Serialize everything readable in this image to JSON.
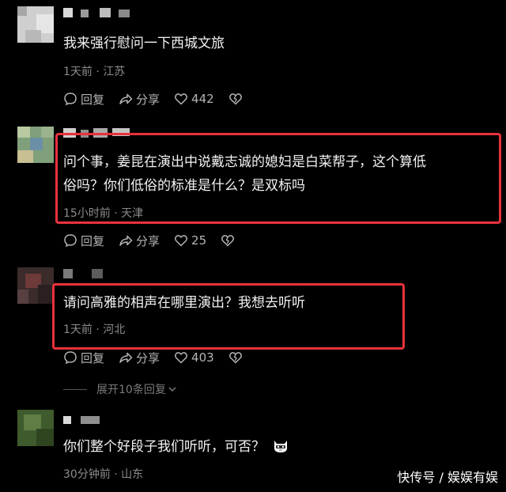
{
  "comments": [
    {
      "text_lines": [
        "我来强行慰问一下西城文旅"
      ],
      "meta": "1天前 · 江苏",
      "reply_label": "回复",
      "share_label": "分享",
      "likes": "442"
    },
    {
      "text_lines": [
        "问个事，姜昆在演出中说戴志诚的媳妇是白菜帮子，这个算低",
        "俗吗？你们低俗的标准是什么？是双标吗"
      ],
      "meta": "15小时前 · 天津",
      "reply_label": "回复",
      "share_label": "分享",
      "likes": "25"
    },
    {
      "text_lines": [
        "请问高雅的相声在哪里演出？我想去听听"
      ],
      "meta": "1天前 · 河北",
      "reply_label": "回复",
      "share_label": "分享",
      "likes": "403",
      "expand_label": "展开10条回复"
    },
    {
      "text_lines": [
        "你们整个好段子我们听听，可否？"
      ],
      "meta": "30分钟前 · 山东"
    }
  ],
  "watermark": "快传号 / 娱娱有娱",
  "colors": {
    "background": "#000000",
    "highlight_box": "#e8323c",
    "meta_text": "#8c8c8c"
  },
  "icons": [
    "comment-icon",
    "share-icon",
    "heart-icon",
    "dislike-heart-icon",
    "emoji-cat-icon",
    "chevron-down-icon"
  ]
}
